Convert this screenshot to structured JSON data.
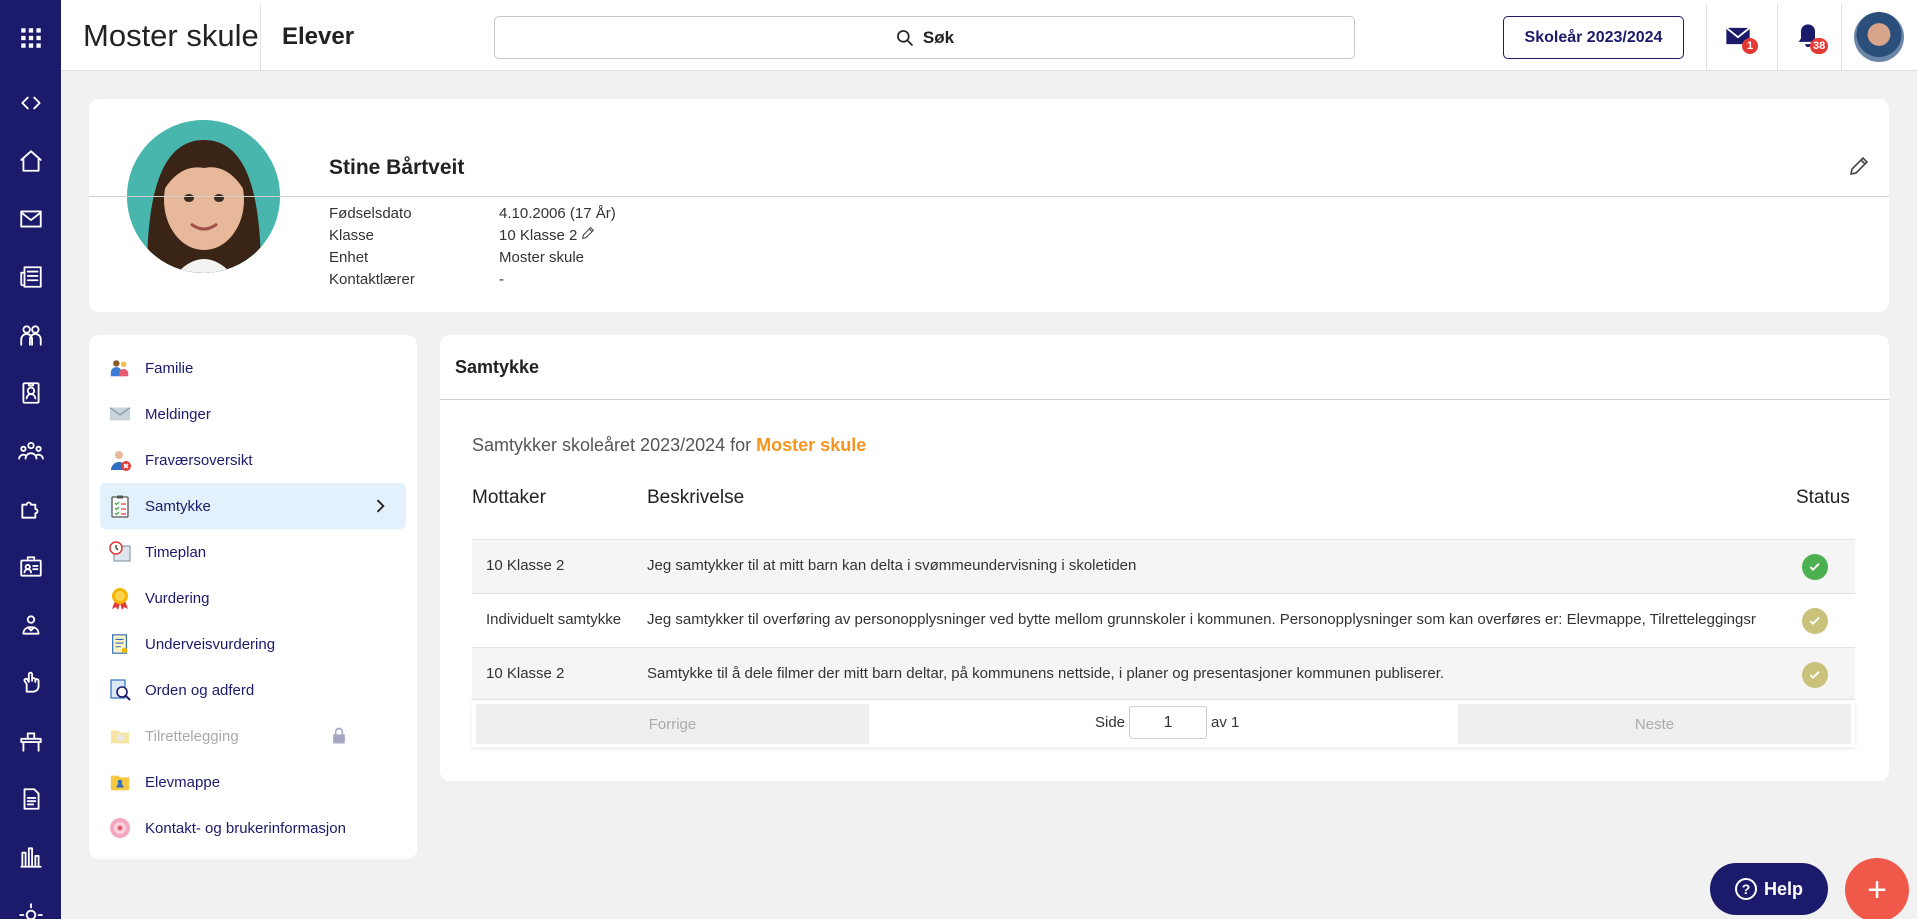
{
  "app": {
    "name": "Moster skule",
    "page": "Elever"
  },
  "search": {
    "label": "Søk"
  },
  "school_year_button": "Skoleår 2023/2024",
  "notifications": {
    "messages_count": "1",
    "alerts_count": "38"
  },
  "rail_icons": [
    "apps-grid-icon",
    "code-toggle-icon",
    "home-icon",
    "mail-icon",
    "news-icon",
    "group-icon",
    "badge-icon",
    "people-icon",
    "puzzle-icon",
    "id-card-icon",
    "person-icon",
    "hand-icon",
    "desk-icon",
    "document-icon",
    "chart-icon",
    "settings-icon"
  ],
  "profile": {
    "name": "Stine Bårtveit",
    "details": [
      {
        "label": "Fødselsdato",
        "value": "4.10.2006 (17 År)"
      },
      {
        "label": "Klasse",
        "value": "10 Klasse 2"
      },
      {
        "label": "Enhet",
        "value": "Moster skule"
      },
      {
        "label": "Kontaktlærer",
        "value": "-"
      }
    ]
  },
  "menu": {
    "items": [
      {
        "label": "Familie",
        "icon": "family-icon"
      },
      {
        "label": "Meldinger",
        "icon": "envelope-icon"
      },
      {
        "label": "Fraværsoversikt",
        "icon": "absence-icon"
      },
      {
        "label": "Samtykke",
        "icon": "clipboard-check-icon",
        "active": true
      },
      {
        "label": "Timeplan",
        "icon": "schedule-icon"
      },
      {
        "label": "Vurdering",
        "icon": "medal-icon"
      },
      {
        "label": "Underveisvurdering",
        "icon": "notes-icon"
      },
      {
        "label": "Orden og adferd",
        "icon": "magnifier-document-icon"
      },
      {
        "label": "Tilrettelegging",
        "icon": "folder-icon",
        "disabled": true
      },
      {
        "label": "Elevmappe",
        "icon": "student-folder-icon"
      },
      {
        "label": "Kontakt- og brukerinformasjon",
        "icon": "contact-info-icon"
      }
    ]
  },
  "panel": {
    "title": "Samtykke",
    "subtitle_prefix": "Samtykker skoleåret 2023/2024 for",
    "subtitle_school": "Moster skule",
    "columns": [
      "Mottaker",
      "Beskrivelse",
      "Status"
    ],
    "rows": [
      {
        "recipient": "10 Klasse 2",
        "description": "Jeg samtykker til at mitt barn kan delta i svømmeundervisning i skoletiden",
        "status": "approved",
        "status_color": "#4caf50"
      },
      {
        "recipient": "Individuelt samtykke",
        "description": "Jeg samtykker til overføring av personopplysninger ved bytte mellom grunnskoler i kommunen. Personopplysninger som kan overføres er: Elevmappe, Tilretteleggingsr",
        "status": "pending",
        "status_color": "#c8c27a"
      },
      {
        "recipient": "10 Klasse 2",
        "description": "Samtykke til å dele filmer der mitt barn deltar, på kommunens nettside, i planer og presentasjoner kommunen publiserer.",
        "status": "pending",
        "status_color": "#c8c27a"
      }
    ],
    "pager": {
      "prev": "Forrige",
      "page_label": "Side",
      "page": "1",
      "of_label": "av 1",
      "next": "Neste"
    }
  },
  "help_button": "Help",
  "fab_label": "+",
  "colors": {
    "brand": "#1c1a6b",
    "accent": "#f7941d",
    "fab": "#f0584a",
    "active_bg": "#e2f1fc"
  }
}
